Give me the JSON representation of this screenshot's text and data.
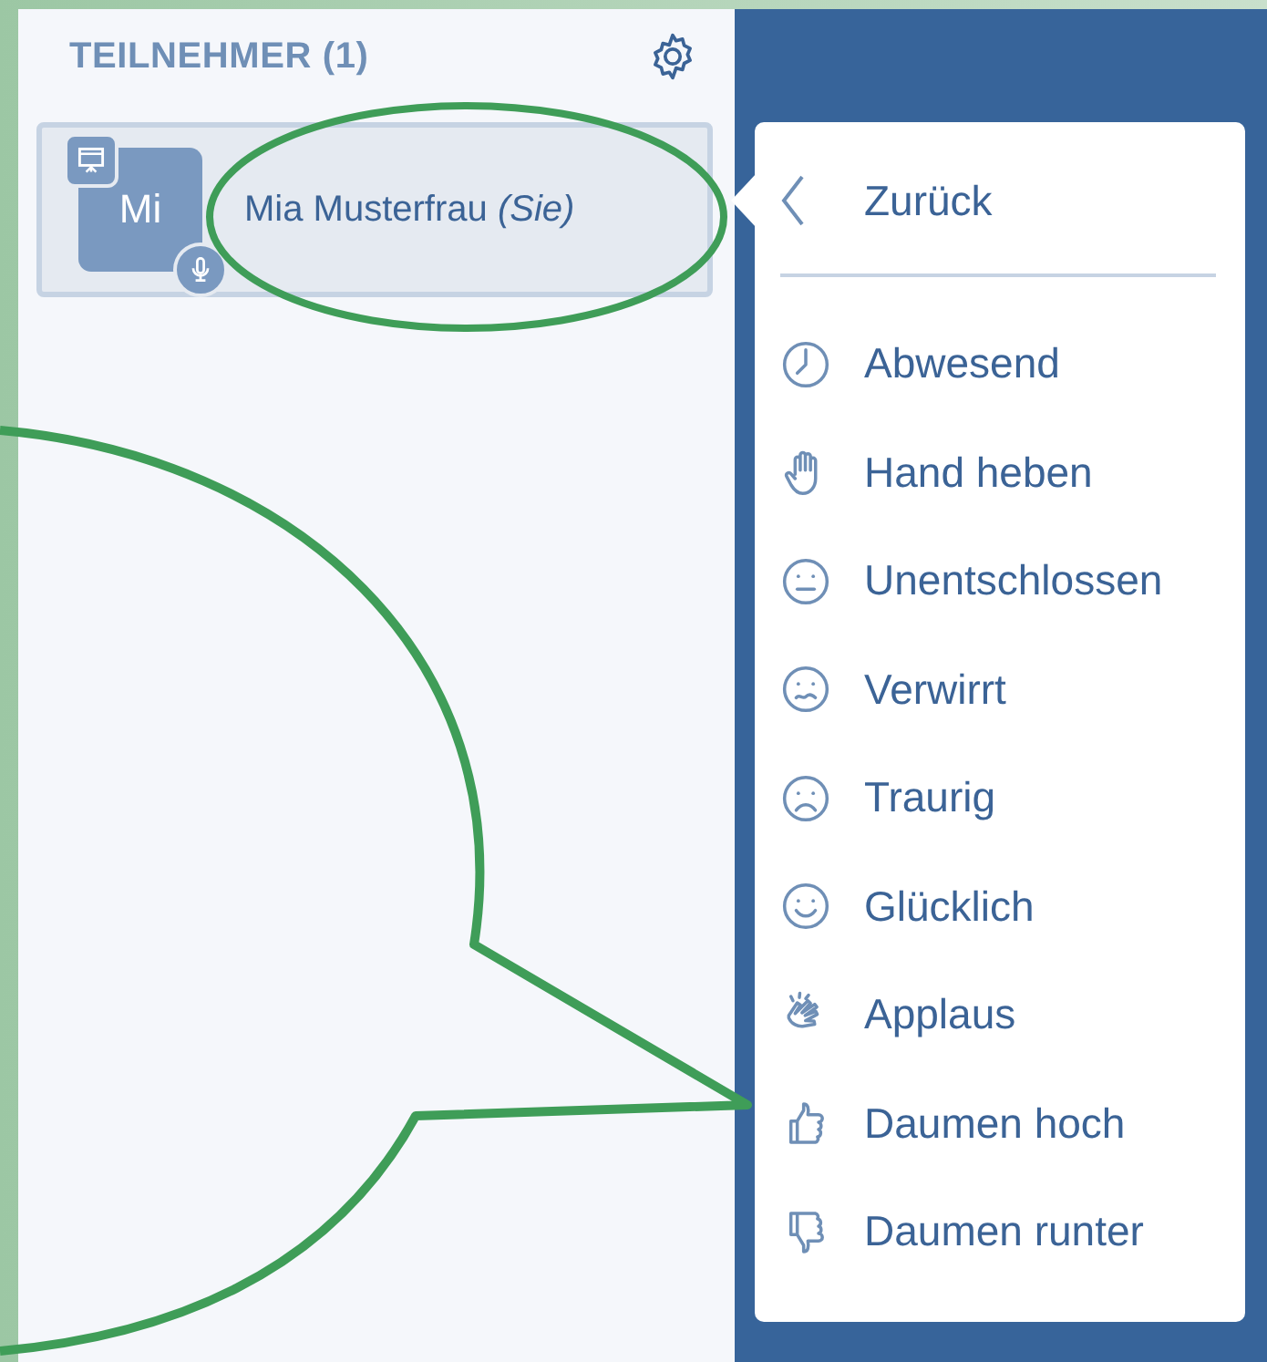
{
  "participants_panel": {
    "title": "TEILNEHMER (1)",
    "participants": [
      {
        "initials": "Mi",
        "name": "Mia Musterfrau *(Sie)*",
        "presenter": true,
        "microphone": true
      }
    ]
  },
  "status_menu": {
    "back": "Zurück",
    "items": [
      {
        "kind": "clock",
        "label": "Abwesend"
      },
      {
        "kind": "hand",
        "label": "Hand heben"
      },
      {
        "kind": "neutral",
        "label": "Unentschlossen"
      },
      {
        "kind": "confused",
        "label": "Verwirrt"
      },
      {
        "kind": "sad",
        "label": "Traurig"
      },
      {
        "kind": "happy",
        "label": "Glücklich"
      },
      {
        "kind": "applause",
        "label": "Applaus"
      },
      {
        "kind": "thumbs-up",
        "label": "Daumen hoch"
      },
      {
        "kind": "thumbs-down",
        "label": "Daumen runter"
      }
    ]
  }
}
